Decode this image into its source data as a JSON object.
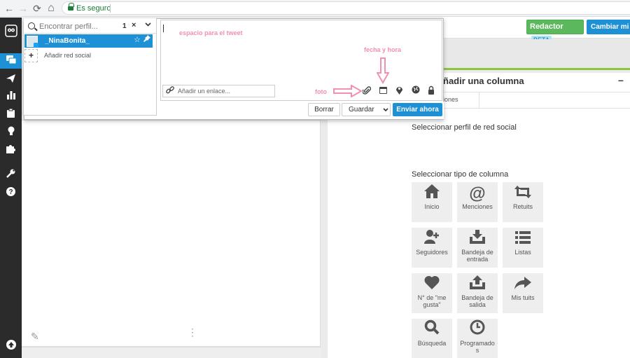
{
  "browser": {
    "secure_label": "Es seguro",
    "back": "←",
    "forward": "→",
    "reload": "⟳",
    "home": "⌂"
  },
  "header": {
    "redactor_label": "Redactor",
    "beta_label": "BETA",
    "cambiar_label": "Cambiar mi p"
  },
  "compose": {
    "search_placeholder": "Encontrar perfil...",
    "selected_count": "1",
    "clear_symbol": "×",
    "expand_symbol": "⌄",
    "profile_name": "_NinaBonita_",
    "add_social_symbol": "+",
    "add_social_label": "Añadir red social",
    "link_placeholder": "Añadir un enlace...",
    "clear_button": "Borrar",
    "save_button": "Guardar",
    "send_button": "Enviar ahora"
  },
  "annotations": {
    "tweet_space": "espacio para el tweet",
    "date_time": "fecha y hora",
    "photo": "foto"
  },
  "add_column": {
    "title": "ñadir una columna",
    "collapse_symbol": "–",
    "tab_mentions": "iones",
    "select_profile": "Seleccionar perfil de red social",
    "select_type": "Seleccionar tipo de columna",
    "tiles": [
      {
        "label": "Inicio",
        "icon": "home-icon"
      },
      {
        "label": "Menciones",
        "icon": "at-icon"
      },
      {
        "label": "Retuits",
        "icon": "retweet-icon"
      },
      {
        "label": "Seguidores",
        "icon": "add-user-icon"
      },
      {
        "label": "Bandeja de entrada",
        "icon": "inbox-icon"
      },
      {
        "label": "Listas",
        "icon": "list-icon"
      },
      {
        "label": "N° de \"me gusta\"",
        "icon": "heart-icon"
      },
      {
        "label": "Bandeja de salida",
        "icon": "outbox-icon"
      },
      {
        "label": "Mis tuits",
        "icon": "share-icon"
      },
      {
        "label": "Búsqueda",
        "icon": "search-icon"
      },
      {
        "label": "Programados",
        "icon": "clock-icon"
      }
    ]
  },
  "colors": {
    "accent": "#1e90d6",
    "green": "#5cb85c",
    "annotation": "#f48fb1",
    "sidebar": "#2b2b2b"
  }
}
